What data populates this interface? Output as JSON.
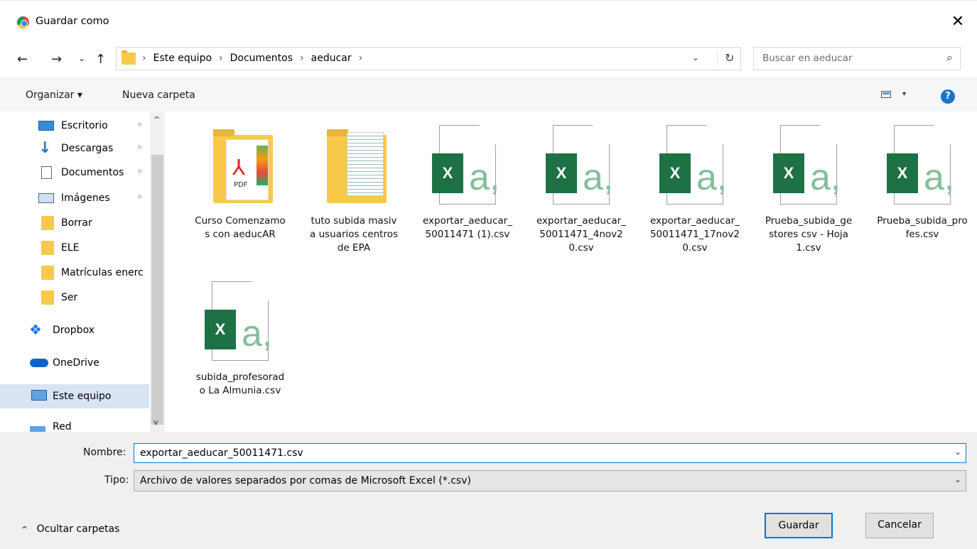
{
  "window": {
    "title": "Guardar como",
    "close_glyph": "✕"
  },
  "nav": {
    "back": "←",
    "forward": "→",
    "recent": "⌄",
    "up": "↑"
  },
  "address": {
    "crumbs": [
      "Este equipo",
      "Documentos",
      "aeducar"
    ],
    "separator": "›",
    "dropdown_glyph": "⌄",
    "refresh_glyph": "↻"
  },
  "search": {
    "placeholder": "Buscar en aeducar",
    "icon": "⌕"
  },
  "toolbar": {
    "organize": "Organizar ▾",
    "new_folder": "Nueva carpeta",
    "help": "?",
    "view_caret": "▾"
  },
  "sidebar": {
    "items": [
      {
        "label": "Escritorio",
        "icon": "desktop-icon",
        "pinned": true
      },
      {
        "label": "Descargas",
        "icon": "downloads-icon",
        "pinned": true
      },
      {
        "label": "Documentos",
        "icon": "documents-icon",
        "pinned": true
      },
      {
        "label": "Imágenes",
        "icon": "pictures-icon",
        "pinned": true
      },
      {
        "label": "Borrar",
        "icon": "folder-icon"
      },
      {
        "label": "ELE",
        "icon": "folder-icon"
      },
      {
        "label": "Matrículas enerc",
        "icon": "folder-icon"
      },
      {
        "label": "Ser",
        "icon": "folder-icon"
      },
      {
        "label": "Dropbox",
        "icon": "dropbox-icon"
      },
      {
        "label": "OneDrive",
        "icon": "onedrive-icon"
      },
      {
        "label": "Este equipo",
        "icon": "this-pc-icon",
        "selected": true
      },
      {
        "label": "Red",
        "icon": "network-icon"
      }
    ],
    "pin_glyph": "📌",
    "scroll_up": "^",
    "scroll_down": "v"
  },
  "files": [
    {
      "name": "Curso Comenzamos con aeducAR",
      "kind": "folder-pdf"
    },
    {
      "name": "tuto subida masiva usuarios centros de EPA",
      "kind": "folder-doc"
    },
    {
      "name": "exportar_aeducar_50011471 (1).csv",
      "kind": "csv"
    },
    {
      "name": "exportar_aeducar_50011471_4nov20.csv",
      "kind": "csv"
    },
    {
      "name": "exportar_aeducar_50011471_17nov20.csv",
      "kind": "csv"
    },
    {
      "name": "Prueba_subida_gestores csv - Hoja 1.csv",
      "kind": "csv"
    },
    {
      "name": "Prueba_subida_profes.csv",
      "kind": "csv"
    },
    {
      "name": "subida_profesorado La Almunia.csv",
      "kind": "csv"
    }
  ],
  "csv_icon": {
    "x": "X",
    "a": "a,"
  },
  "pdf_icon": {
    "label": "PDF"
  },
  "form": {
    "name_label": "Nombre:",
    "name_value": "exportar_aeducar_50011471.csv",
    "type_label": "Tipo:",
    "type_value": "Archivo de valores separados por comas de Microsoft Excel (*.csv)",
    "dropdown_glyph": "⌄"
  },
  "footer": {
    "hide_folders": "Ocultar carpetas",
    "hide_arrow": "^",
    "save": "Guardar",
    "cancel": "Cancelar"
  },
  "colors": {
    "accent": "#0078d7",
    "excel_green": "#1e7145",
    "folder_yellow": "#f8c94a",
    "selected_bg": "#d9e4f2"
  }
}
